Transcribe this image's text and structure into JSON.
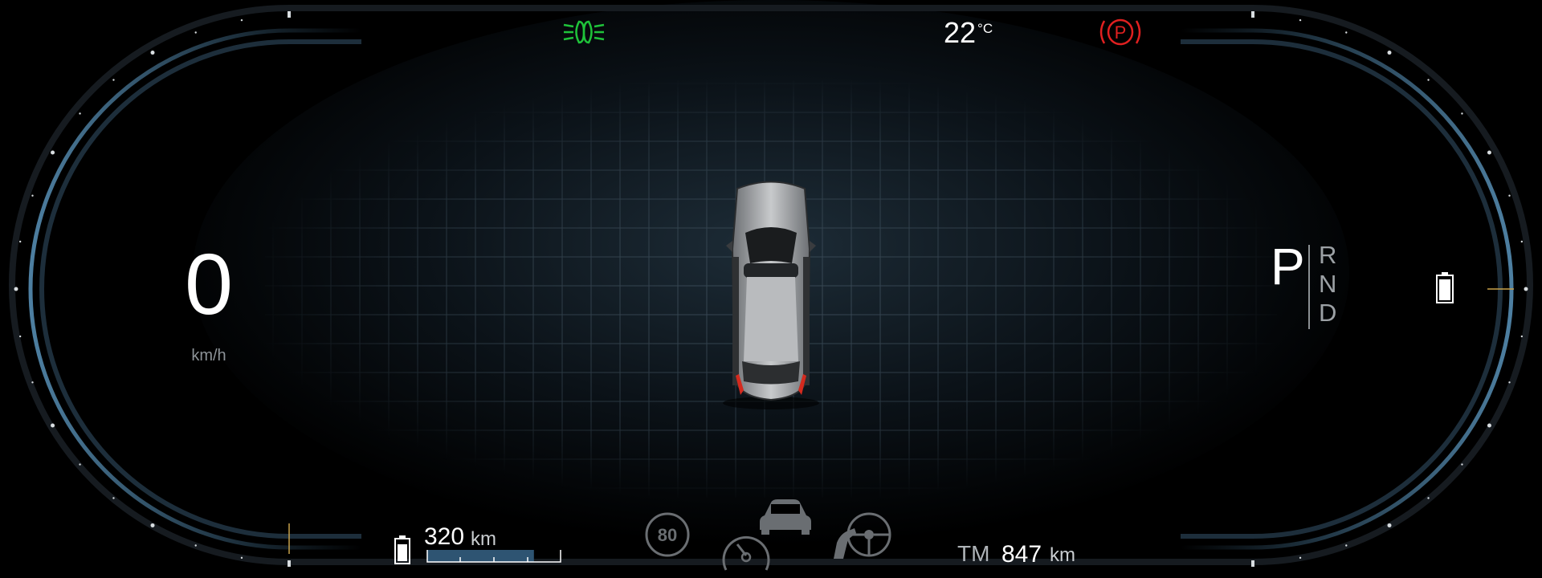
{
  "speedometer": {
    "value": "0",
    "unit": "km/h"
  },
  "gear_selector": {
    "active": "P",
    "others": [
      "R",
      "N",
      "D"
    ]
  },
  "indicators": {
    "headlight_icon": "headlight-low-beam-icon",
    "headlight_color": "#1fc33a",
    "parking_brake_label": "P",
    "parking_brake_color": "#e02020"
  },
  "temperature": {
    "value": "22",
    "unit": "°C"
  },
  "range": {
    "value": "320",
    "unit": "km",
    "battery_level": 0.8
  },
  "speed_limit": {
    "value": "80"
  },
  "trip": {
    "label": "TM",
    "value": "847",
    "unit": "km"
  },
  "colors": {
    "accent": "#4b7a9b",
    "text_muted": "#8d9398",
    "grid": "#2a3640"
  }
}
